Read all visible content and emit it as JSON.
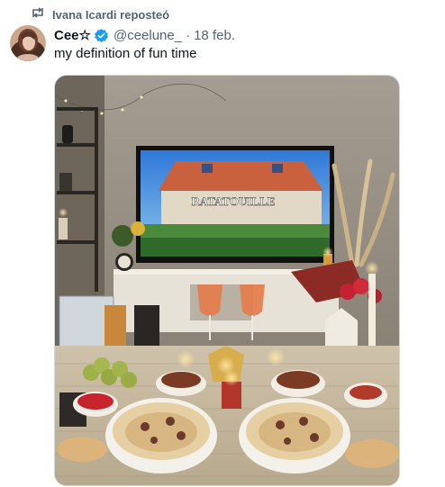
{
  "repost": {
    "icon": "repost-icon",
    "text": "Ivana Icardi reposteó"
  },
  "tweet": {
    "author_name": "Cee☆",
    "verified_icon": "verified-badge-icon",
    "handle": "@ceelune_",
    "separator": "·",
    "date": "18 feb.",
    "text": "my definition of fun time"
  },
  "media": {
    "tv_title": "RATATOUILLE"
  },
  "colors": {
    "muted": "#536471",
    "verified": "#1d9bf0",
    "text": "#0f1419",
    "border": "#cfd9de"
  }
}
